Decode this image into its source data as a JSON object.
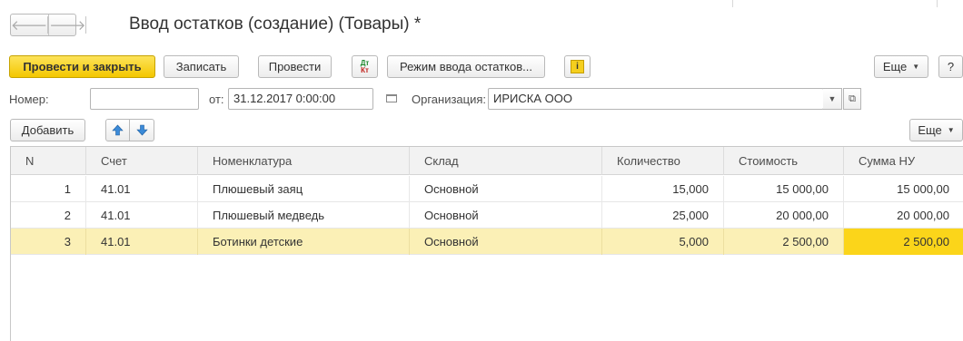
{
  "window": {
    "title": "Ввод остатков (создание) (Товары) *"
  },
  "nav": {
    "back_icon": "arrow-left-icon",
    "forward_icon": "arrow-right-icon"
  },
  "toolbar": {
    "post_close_label": "Провести и закрыть",
    "save_label": "Записать",
    "post_label": "Провести",
    "dtkt_top": "Дт",
    "dtkt_bottom": "Кт",
    "mode_label": "Режим ввода остатков...",
    "info_icon": "i",
    "more_label": "Еще",
    "help_label": "?"
  },
  "form": {
    "number_label": "Номер:",
    "number_value": "",
    "date_label": "от:",
    "date_value": "31.12.2017  0:00:00",
    "org_label": "Организация:",
    "org_value": "ИРИСКА ООО"
  },
  "table_toolbar": {
    "add_label": "Добавить",
    "more_label": "Еще"
  },
  "table": {
    "columns": [
      "N",
      "Счет",
      "Номенклатура",
      "Склад",
      "Количество",
      "Стоимость",
      "Сумма НУ"
    ],
    "rows": [
      {
        "n": "1",
        "account": "41.01",
        "item": "Плюшевый заяц",
        "warehouse": "Основной",
        "qty": "15,000",
        "cost": "15 000,00",
        "sum_nu": "15 000,00"
      },
      {
        "n": "2",
        "account": "41.01",
        "item": "Плюшевый медведь",
        "warehouse": "Основной",
        "qty": "25,000",
        "cost": "20 000,00",
        "sum_nu": "20 000,00"
      },
      {
        "n": "3",
        "account": "41.01",
        "item": "Ботинки детские",
        "warehouse": "Основной",
        "qty": "5,000",
        "cost": "2 500,00",
        "sum_nu": "2 500,00"
      }
    ]
  },
  "colors": {
    "primary_button": "#f4c700",
    "selected_row": "#fbf0b6",
    "active_cell": "#fbd51a"
  }
}
